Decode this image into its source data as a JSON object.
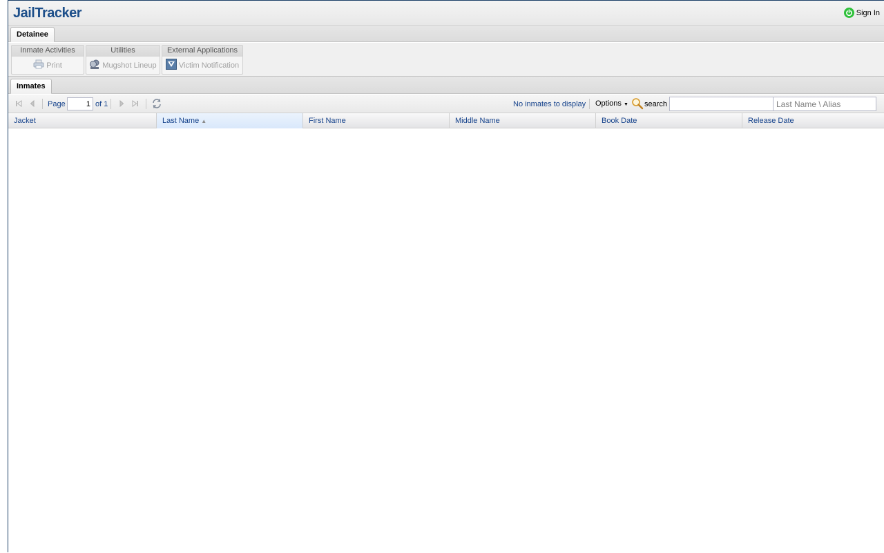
{
  "header": {
    "logo_text": "JailTracker",
    "signin_label": "Sign In"
  },
  "main_tabs": [
    {
      "label": "Detainee"
    }
  ],
  "ribbon": {
    "groups": [
      {
        "title": "Inmate Activities",
        "button": "Print"
      },
      {
        "title": "Utilities",
        "button": "Mugshot Lineup"
      },
      {
        "title": "External Applications",
        "button": "Victim Notification"
      }
    ]
  },
  "sub_tabs": [
    {
      "label": "Inmates"
    }
  ],
  "pager": {
    "page_label": "Page",
    "page_value": "1",
    "of_label": "of 1",
    "status": "No inmates to display",
    "options_label": "Options",
    "search_label": "search",
    "search_value": "",
    "alias_placeholder": "Last Name \\ Alias"
  },
  "grid": {
    "columns": [
      "Jacket",
      "Last Name",
      "First Name",
      "Middle Name",
      "Book Date",
      "Release Date"
    ],
    "sorted_column": "Last Name",
    "rows": []
  },
  "colors": {
    "accent": "#15428b",
    "logo": "#1d4f8a",
    "signin_icon": "#2ec03a"
  }
}
